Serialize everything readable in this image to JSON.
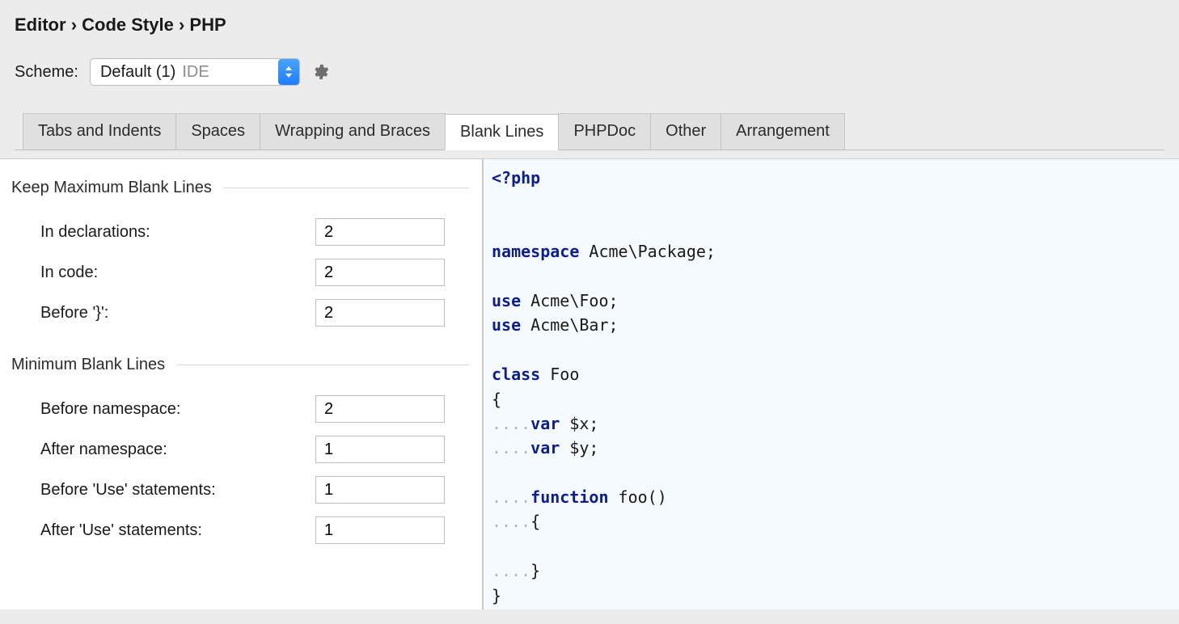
{
  "breadcrumb": {
    "seg1": "Editor",
    "sep": "›",
    "seg2": "Code Style",
    "seg3": "PHP"
  },
  "scheme": {
    "label": "Scheme:",
    "value": "Default (1)",
    "scope": "IDE"
  },
  "tabs": {
    "tabs_and_indents": "Tabs and Indents",
    "spaces": "Spaces",
    "wrapping": "Wrapping and Braces",
    "blank_lines": "Blank Lines",
    "phpdoc": "PHPDoc",
    "other": "Other",
    "arrangement": "Arrangement"
  },
  "sections": {
    "keep_max": {
      "title": "Keep Maximum Blank Lines",
      "in_declarations": {
        "label": "In declarations:",
        "value": "2"
      },
      "in_code": {
        "label": "In code:",
        "value": "2"
      },
      "before_brace": {
        "label": "Before '}':",
        "value": "2"
      }
    },
    "min": {
      "title": "Minimum Blank Lines",
      "before_ns": {
        "label": "Before namespace:",
        "value": "2"
      },
      "after_ns": {
        "label": "After namespace:",
        "value": "1"
      },
      "before_use": {
        "label": "Before 'Use' statements:",
        "value": "1"
      },
      "after_use": {
        "label": "After 'Use' statements:",
        "value": "1"
      }
    }
  },
  "preview": {
    "l1a": "<?php",
    "l3a": "namespace",
    "l3b": " Acme\\Package;",
    "l5a": "use",
    "l5b": " Acme\\Foo;",
    "l6a": "use",
    "l6b": " Acme\\Bar;",
    "l8a": "class",
    "l8b": " Foo",
    "l9": "{",
    "l10a": "var",
    "l10b": " $x;",
    "l11a": "var",
    "l11b": " $y;",
    "l13a": "function",
    "l13b": " foo()",
    "l14": "{",
    "l16": "}",
    "l17": "}",
    "ind": "    ",
    "dots": "...."
  }
}
